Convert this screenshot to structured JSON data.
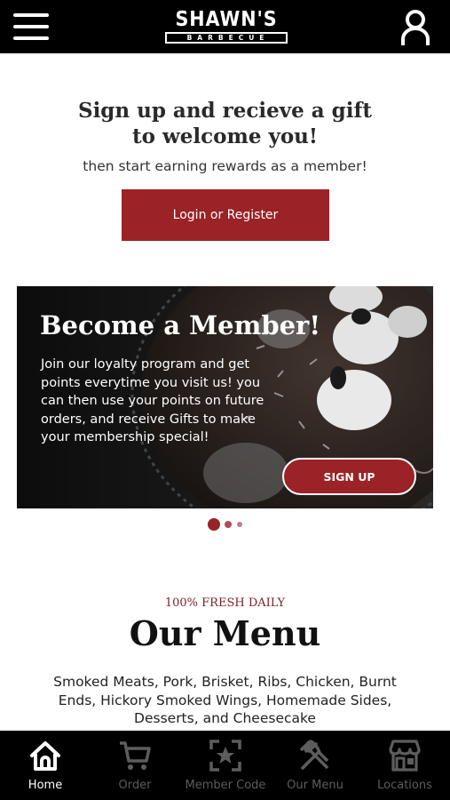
{
  "header": {
    "logo_main": "SHAWN'S",
    "logo_sub": "BARBECUE",
    "menu_icon": "hamburger-menu-icon",
    "account_icon": "user-account-icon"
  },
  "signup": {
    "title_line1": "Sign up and recieve a gift",
    "title_line2": "to welcome you!",
    "subtitle": "then start earning rewards as a member!",
    "login_label": "Login or Register"
  },
  "banner": {
    "title": "Become a Member!",
    "text": "Join our loyalty program and get points everytime you visit us! you can then use your points on future orders, and receive Gifts to make your membership special!",
    "button_label": "SIGN UP",
    "active_slide": 1,
    "slide_count": 3
  },
  "menu_section": {
    "eyebrow": "100% FRESH DAILY",
    "title": "Our Menu",
    "description": "Smoked Meats, Pork, Brisket, Ribs, Chicken, Burnt Ends, Hickory Smoked Wings, Homemade Sides, Desserts, and Cheesecake"
  },
  "bottom_nav": [
    {
      "label": "Home",
      "icon": "home-icon",
      "active": true
    },
    {
      "label": "Order",
      "icon": "cart-icon",
      "active": false
    },
    {
      "label": "Member Code",
      "icon": "qr-star-icon",
      "active": false
    },
    {
      "label": "Our Menu",
      "icon": "fork-knife-icon",
      "active": false
    },
    {
      "label": "Locations",
      "icon": "storefront-icon",
      "active": false
    }
  ],
  "colors": {
    "brand_red": "#9b2226",
    "header_bg": "#000000",
    "nav_inactive": "#5d5d5d",
    "nav_active": "#ffffff"
  }
}
